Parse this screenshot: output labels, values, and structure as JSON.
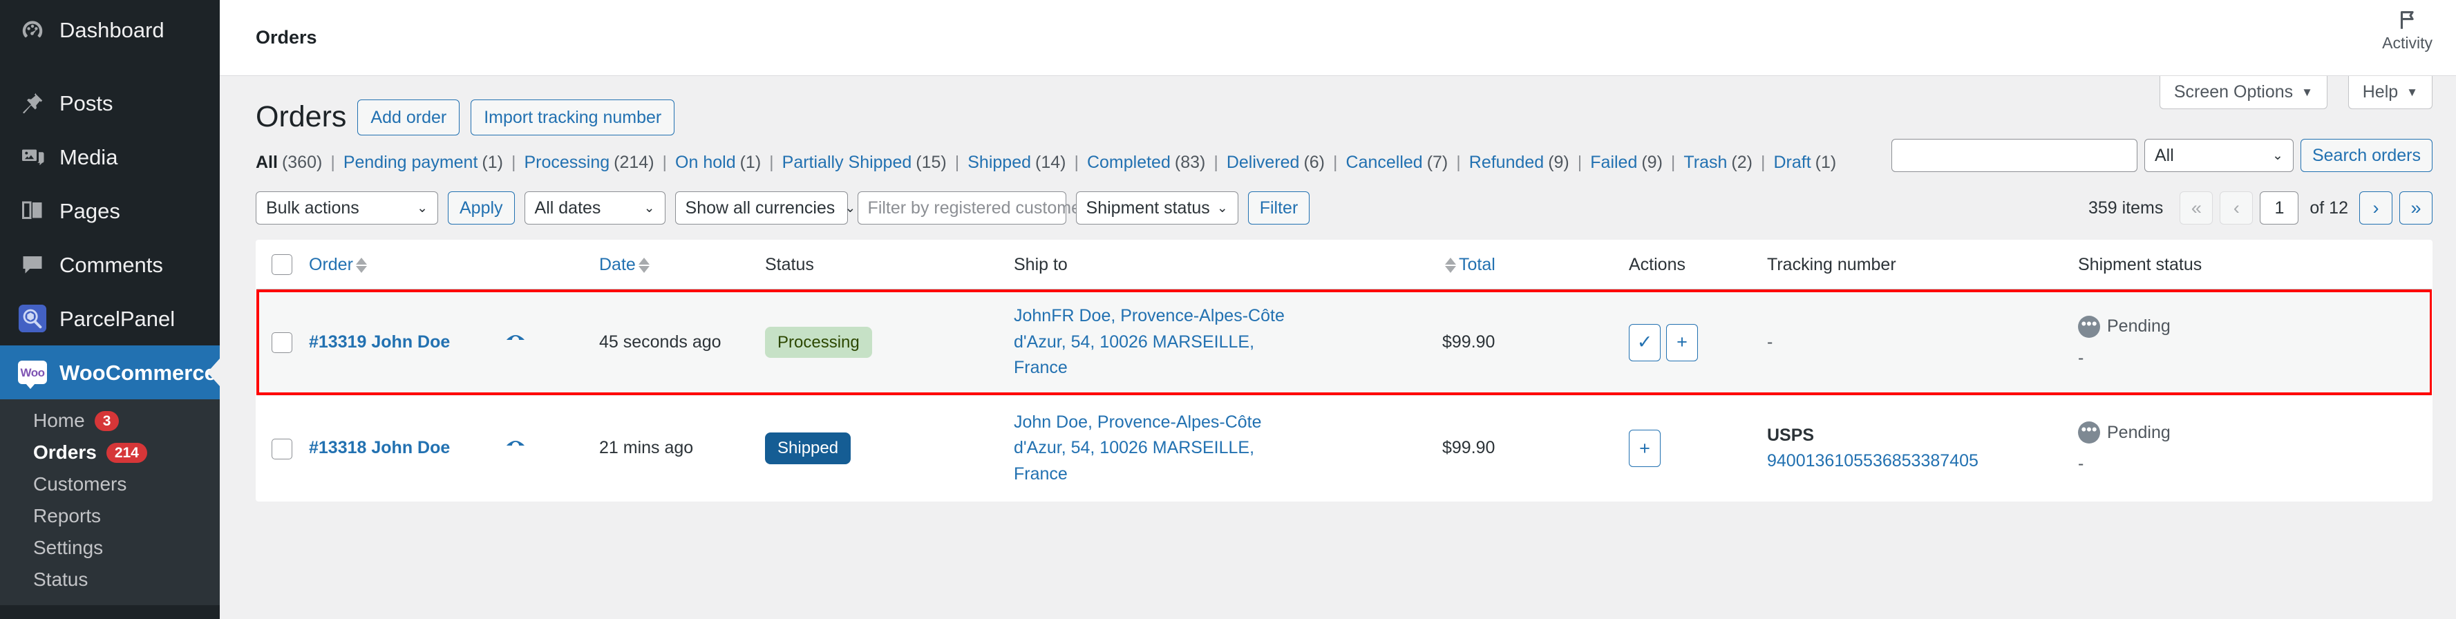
{
  "sidebar": {
    "items": [
      {
        "label": "Dashboard",
        "icon": "dashboard-icon"
      },
      {
        "label": "Posts",
        "icon": "pin-icon"
      },
      {
        "label": "Media",
        "icon": "media-icon"
      },
      {
        "label": "Pages",
        "icon": "pages-icon"
      },
      {
        "label": "Comments",
        "icon": "comment-icon"
      },
      {
        "label": "ParcelPanel",
        "icon": "parcelpanel-icon"
      },
      {
        "label": "WooCommerce",
        "icon": "woo-icon",
        "active": true
      }
    ],
    "woo_badge_text": "Woo",
    "submenu": [
      {
        "label": "Home",
        "count": "3"
      },
      {
        "label": "Orders",
        "count": "214",
        "current": true
      },
      {
        "label": "Customers",
        "count": ""
      },
      {
        "label": "Reports",
        "count": ""
      },
      {
        "label": "Settings",
        "count": ""
      },
      {
        "label": "Status",
        "count": ""
      }
    ]
  },
  "topbar": {
    "breadcrumb": "Orders",
    "activity_label": "Activity"
  },
  "screen_meta": {
    "screen_options_label": "Screen Options",
    "help_label": "Help",
    "caret": "▼"
  },
  "heading": {
    "title": "Orders",
    "add_order_label": "Add order",
    "import_tracking_label": "Import tracking number"
  },
  "status_links": [
    {
      "label": "All",
      "count": "(360)",
      "current": true
    },
    {
      "label": "Pending payment",
      "count": "(1)"
    },
    {
      "label": "Processing",
      "count": "(214)"
    },
    {
      "label": "On hold",
      "count": "(1)"
    },
    {
      "label": "Partially Shipped",
      "count": "(15)"
    },
    {
      "label": "Shipped",
      "count": "(14)"
    },
    {
      "label": "Completed",
      "count": "(83)"
    },
    {
      "label": "Delivered",
      "count": "(6)"
    },
    {
      "label": "Cancelled",
      "count": "(7)"
    },
    {
      "label": "Refunded",
      "count": "(9)"
    },
    {
      "label": "Failed",
      "count": "(9)"
    },
    {
      "label": "Trash",
      "count": "(2)"
    },
    {
      "label": "Draft",
      "count": "(1)"
    }
  ],
  "search": {
    "input_value": "",
    "input_placeholder": "",
    "scope_value": "All",
    "button_label": "Search orders"
  },
  "filters": {
    "bulk_actions_value": "Bulk actions",
    "apply_label": "Apply",
    "dates_value": "All dates",
    "currency_value": "Show all currencies",
    "customer_placeholder": "Filter by registered customer",
    "shipment_status_value": "Shipment status",
    "filter_label": "Filter"
  },
  "pagination": {
    "items_text": "359 items",
    "first_label": "«",
    "prev_label": "‹",
    "current_page": "1",
    "of_text": "of 12",
    "next_label": "›",
    "last_label": "»"
  },
  "table": {
    "columns": [
      {
        "label": "Order",
        "sortable": true
      },
      {
        "label": "Date",
        "sortable": true
      },
      {
        "label": "Status",
        "sortable": false
      },
      {
        "label": "Ship to",
        "sortable": false
      },
      {
        "label": "Total",
        "sortable": true
      },
      {
        "label": "Actions",
        "sortable": false
      },
      {
        "label": "Tracking number",
        "sortable": false
      },
      {
        "label": "Shipment status",
        "sortable": false
      }
    ],
    "rows": [
      {
        "order": "#13319 John Doe",
        "preview_icon": "eye-icon",
        "date": "45 seconds ago",
        "status": "Processing",
        "status_kind": "processing",
        "ship_to": "JohnFR Doe, Provence-Alpes-Côte d'Azur, 54, 10026 MARSEILLE, France",
        "total": "$99.90",
        "actions": [
          "✓",
          "+"
        ],
        "tracking_carrier": "",
        "tracking_number": "-",
        "shipment_status": "Pending",
        "shipment_substatus": "-",
        "highlighted": true
      },
      {
        "order": "#13318 John Doe",
        "preview_icon": "eye-icon",
        "date": "21 mins ago",
        "status": "Shipped",
        "status_kind": "shipped",
        "ship_to": "John Doe, Provence-Alpes-Côte d'Azur, 54, 10026 MARSEILLE, France",
        "total": "$99.90",
        "actions": [
          "+"
        ],
        "tracking_carrier": "USPS",
        "tracking_number": "9400136105536853387405",
        "shipment_status": "Pending",
        "shipment_substatus": "-",
        "highlighted": false
      }
    ]
  },
  "colors": {
    "wp_blue": "#2271b1",
    "sidebar_bg": "#1d2327",
    "submenu_bg": "#2c3338",
    "badge_red": "#d63638",
    "processing_bg": "#c6e1c6",
    "processing_fg": "#2c4700",
    "shipped_bg": "#155d94",
    "highlight_outline": "#ff0000"
  }
}
